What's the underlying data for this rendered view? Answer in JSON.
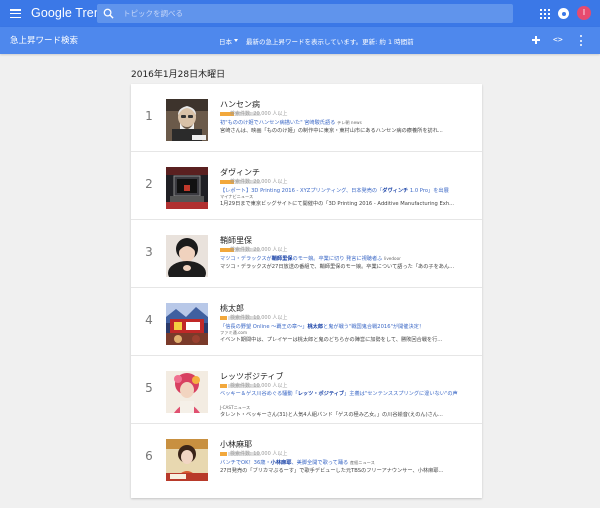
{
  "app": {
    "title": "Google Trends",
    "search_placeholder": "トピックを調べる",
    "avatar_letter": "I"
  },
  "subbar": {
    "page_title": "急上昇ワード検索",
    "region": "日本",
    "status": "最新の急上昇ワードを表示しています。更新: 約 1 時間前"
  },
  "date_heading": "2016年1月28日木曜日",
  "colors": {
    "topbar": "#3b78e7",
    "subbar": "#4e88ed",
    "bar": "#f2a83c",
    "link": "#3b68c6"
  },
  "trends": [
    {
      "rank": "1",
      "title": "ハンセン病",
      "volume": "検索件数: 20,000 人以上",
      "bar_fraction": 0.35,
      "link_pre": "初\"もののけ姫でハンセン病描いた\" 宮崎駿氏語る",
      "link_bold": "",
      "link_post": "",
      "source": "テレ朝 news",
      "snippet": "宮崎さんは、映画「もののけ姫」の制作中に東京・東村山市にあるハンセン病の療養所を訪れ..."
    },
    {
      "rank": "2",
      "title": "ダヴィンチ",
      "volume": "検索件数: 20,000 人以上",
      "bar_fraction": 0.35,
      "link_pre": "【レポート】3D Printing 2016 - XYZプリンティング、日本発売の「",
      "link_bold": "ダヴィンチ",
      "link_post": " 1.0 Pro」を出展",
      "source": "マイナビニュース",
      "snippet": "1月29日まで東京ビッグサイトにて開催中の「3D Printing 2016 - Additive Manufacturing Exh..."
    },
    {
      "rank": "3",
      "title": "鞘師里保",
      "volume": "検索件数: 20,000 人以上",
      "bar_fraction": 0.35,
      "link_pre": "マツコ・デラックスが",
      "link_bold": "鞘師里保",
      "link_post": "のモー娘。卒業に切り 発言に視聴者ふ",
      "source": "livedoor",
      "snippet": "マツコ・デラックスが27日放送の番組で、鞘師里保のモー娘。卒業について語った「あの子をあん..."
    },
    {
      "rank": "4",
      "title": "桃太郎",
      "volume": "検索件数: 10,000 人以上",
      "bar_fraction": 0.18,
      "link_pre": "「信長の野望 Online ～覇王の章～」",
      "link_bold": "桃太郎",
      "link_post": "と鬼が戦う\"戦国鬼合戦2016\"が開催決定！",
      "source": "ファミ通.com",
      "snippet": "イベント期間中は、プレイヤーは桃太郎と鬼のどちらかの陣営に加勢をして、勝敗回合戦を行..."
    },
    {
      "rank": "5",
      "title": "レッツポジティブ",
      "volume": "検索件数: 10,000 人以上",
      "bar_fraction": 0.18,
      "link_pre": "ベッキー＆ゲス川谷めぐる騒動「",
      "link_bold": "レッツ・ポジティブ",
      "link_post": "」主義は\"センテンススプリングに違いない\"の声",
      "source": "J-CASTニュース",
      "snippet": "タレント・ベッキーさん(31)と人気4人組バンド「ゲスの極み乙女。」の川谷絵音(えのん)さん..."
    },
    {
      "rank": "6",
      "title": "小林麻耶",
      "volume": "検索件数: 10,000 人以上",
      "bar_fraction": 0.18,
      "link_pre": "バンチでOK！36歳・",
      "link_bold": "小林麻耶",
      "link_post": "、美脚全開で歌って踊る",
      "source": "産経ニュース",
      "snippet": "27日発売の「ブリカマぶるーす」で歌手デビューした元TBSのフリーアナウンサー、小林麻耶..."
    }
  ]
}
